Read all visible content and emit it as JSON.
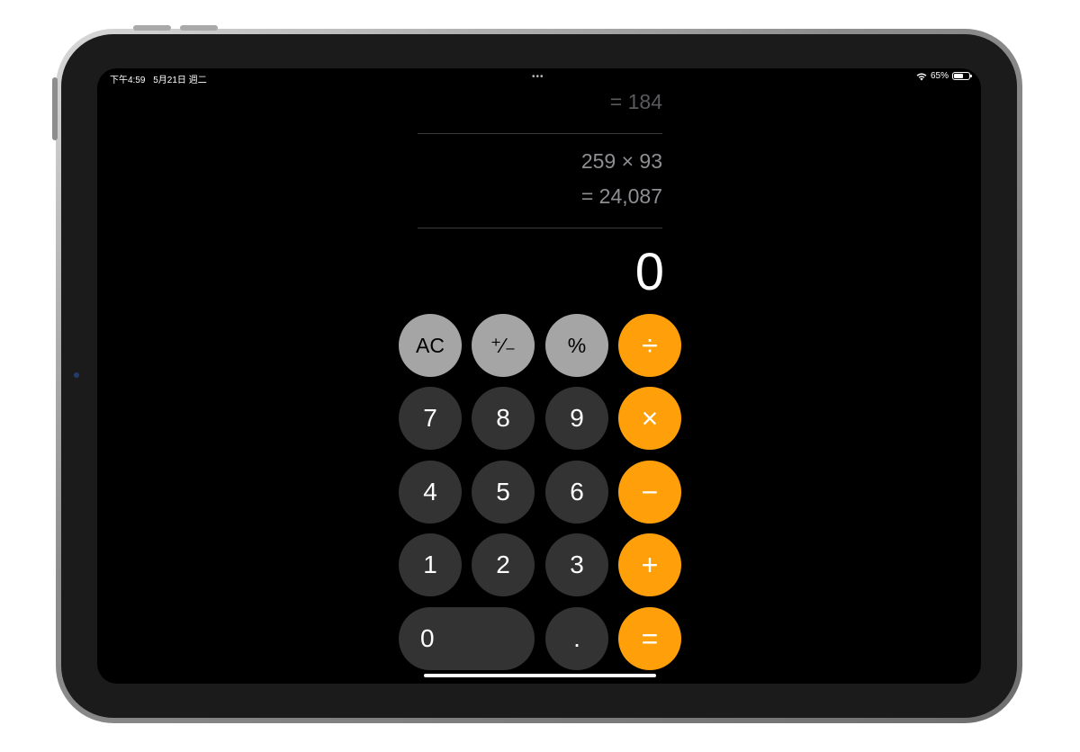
{
  "status_bar": {
    "time": "下午4:59",
    "date": "5月21日 週二",
    "multitask": "•••",
    "battery": "65%",
    "battery_level": 0.65
  },
  "history": [
    {
      "result": "= 184"
    },
    {
      "expression": "259 × 93",
      "result": "= 24,087"
    }
  ],
  "display": "0",
  "keys": {
    "ac": "AC",
    "plus_minus": "⁺∕₋",
    "percent": "%",
    "divide": "÷",
    "seven": "7",
    "eight": "8",
    "nine": "9",
    "multiply": "×",
    "four": "4",
    "five": "5",
    "six": "6",
    "minus": "−",
    "one": "1",
    "two": "2",
    "three": "3",
    "plus": "+",
    "zero": "0",
    "decimal": ".",
    "equals": "="
  },
  "colors": {
    "operator": "#ff9f0a",
    "function": "#a5a5a5",
    "digit": "#333333",
    "background": "#000000"
  }
}
